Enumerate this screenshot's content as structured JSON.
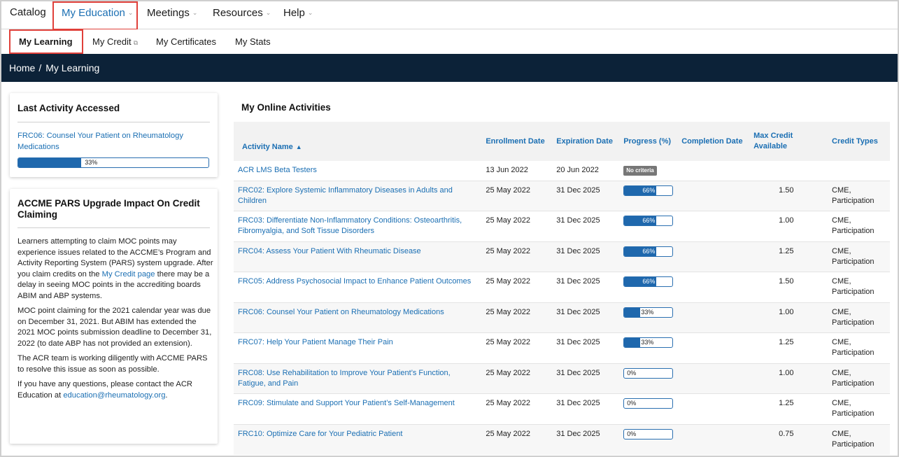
{
  "topnav": {
    "items": [
      {
        "label": "Catalog"
      },
      {
        "label": "My Education",
        "chevron": "⌄"
      },
      {
        "label": "Meetings",
        "chevron": "⌄"
      },
      {
        "label": "Resources",
        "chevron": "⌄"
      },
      {
        "label": "Help",
        "chevron": "⌄"
      }
    ]
  },
  "subnav": {
    "items": [
      {
        "label": "My Learning"
      },
      {
        "label": "My Credit",
        "icon": "external-link-icon"
      },
      {
        "label": "My Certificates"
      },
      {
        "label": "My Stats"
      }
    ]
  },
  "breadcrumb": {
    "home": "Home",
    "separator": "/",
    "current": "My Learning"
  },
  "last_activity": {
    "title": "Last Activity Accessed",
    "link": "FRC06: Counsel Your Patient on Rheumatology Medications",
    "progress_label": "33%",
    "progress": 0.33
  },
  "notice": {
    "title": "ACCME PARS Upgrade Impact On Credit Claiming",
    "p1_a": "Learners attempting to claim MOC points may experience issues related to the ACCME’s Program and Activity Reporting System (PARS) system upgrade. After you claim credits on the ",
    "p1_link": "My Credit page",
    "p1_b": " there may be a delay in seeing MOC points in the accrediting boards ABIM and ABP systems.",
    "p2": "MOC point claiming for the 2021 calendar year was due on December 31, 2021. But ABIM has extended the 2021 MOC points submission deadline to December 31, 2022 (to date ABP has not provided an extension).",
    "p3": "The ACR team is working diligently with ACCME PARS to resolve this issue as soon as possible.",
    "p4_a": "If you have any questions, please contact the ACR Education at ",
    "p4_link": "education@rheumatology.org",
    "p4_b": "."
  },
  "activities": {
    "title": "My Online Activities",
    "columns": {
      "name": "Activity Name",
      "enrollment": "Enrollment Date",
      "expiration": "Expiration Date",
      "progress": "Progress (%)",
      "completion": "Completion Date",
      "max_credit": "Max Credit Available",
      "credit_types": "Credit Types"
    },
    "rows": [
      {
        "name": "ACR LMS Beta Testers",
        "enrollment": "13 Jun 2022",
        "expiration": "20 Jun 2022",
        "badge": "No criteria",
        "completion": "",
        "credit": "",
        "types": ""
      },
      {
        "name": "FRC02: Explore Systemic Inflammatory Diseases in Adults and Children",
        "enrollment": "25 May 2022",
        "expiration": "31 Dec 2025",
        "progress": 0.66,
        "progress_label": "66%",
        "completion": "",
        "credit": "1.50",
        "types": "CME, Participation"
      },
      {
        "name": "FRC03: Differentiate Non-Inflammatory Conditions: Osteoarthritis, Fibromyalgia, and Soft Tissue Disorders",
        "enrollment": "25 May 2022",
        "expiration": "31 Dec 2025",
        "progress": 0.66,
        "progress_label": "66%",
        "completion": "",
        "credit": "1.00",
        "types": "CME, Participation"
      },
      {
        "name": "FRC04: Assess Your Patient With Rheumatic Disease",
        "enrollment": "25 May 2022",
        "expiration": "31 Dec 2025",
        "progress": 0.66,
        "progress_label": "66%",
        "completion": "",
        "credit": "1.25",
        "types": "CME, Participation"
      },
      {
        "name": "FRC05: Address Psychosocial Impact to Enhance Patient Outcomes",
        "enrollment": "25 May 2022",
        "expiration": "31 Dec 2025",
        "progress": 0.66,
        "progress_label": "66%",
        "completion": "",
        "credit": "1.50",
        "types": "CME, Participation"
      },
      {
        "name": "FRC06: Counsel Your Patient on Rheumatology Medications",
        "enrollment": "25 May 2022",
        "expiration": "31 Dec 2025",
        "progress": 0.33,
        "progress_label": "33%",
        "completion": "",
        "credit": "1.00",
        "types": "CME, Participation"
      },
      {
        "name": "FRC07: Help Your Patient Manage Their Pain",
        "enrollment": "25 May 2022",
        "expiration": "31 Dec 2025",
        "progress": 0.33,
        "progress_label": "33%",
        "completion": "",
        "credit": "1.25",
        "types": "CME, Participation"
      },
      {
        "name": "FRC08: Use Rehabilitation to Improve Your Patient’s Function, Fatigue, and Pain",
        "enrollment": "25 May 2022",
        "expiration": "31 Dec 2025",
        "progress": 0,
        "progress_label": "0%",
        "completion": "",
        "credit": "1.00",
        "types": "CME, Participation"
      },
      {
        "name": "FRC09: Stimulate and Support Your Patient’s Self-Management",
        "enrollment": "25 May 2022",
        "expiration": "31 Dec 2025",
        "progress": 0,
        "progress_label": "0%",
        "completion": "",
        "credit": "1.25",
        "types": "CME, Participation"
      },
      {
        "name": "FRC10: Optimize Care for Your Pediatric Patient",
        "enrollment": "25 May 2022",
        "expiration": "31 Dec 2025",
        "progress": 0,
        "progress_label": "0%",
        "completion": "",
        "credit": "0.75",
        "types": "CME, Participation"
      }
    ]
  },
  "colors": {
    "accent": "#1b6fb3",
    "navbar": "#0c2238",
    "highlight": "#e0403a",
    "progress": "#1f68ad"
  }
}
